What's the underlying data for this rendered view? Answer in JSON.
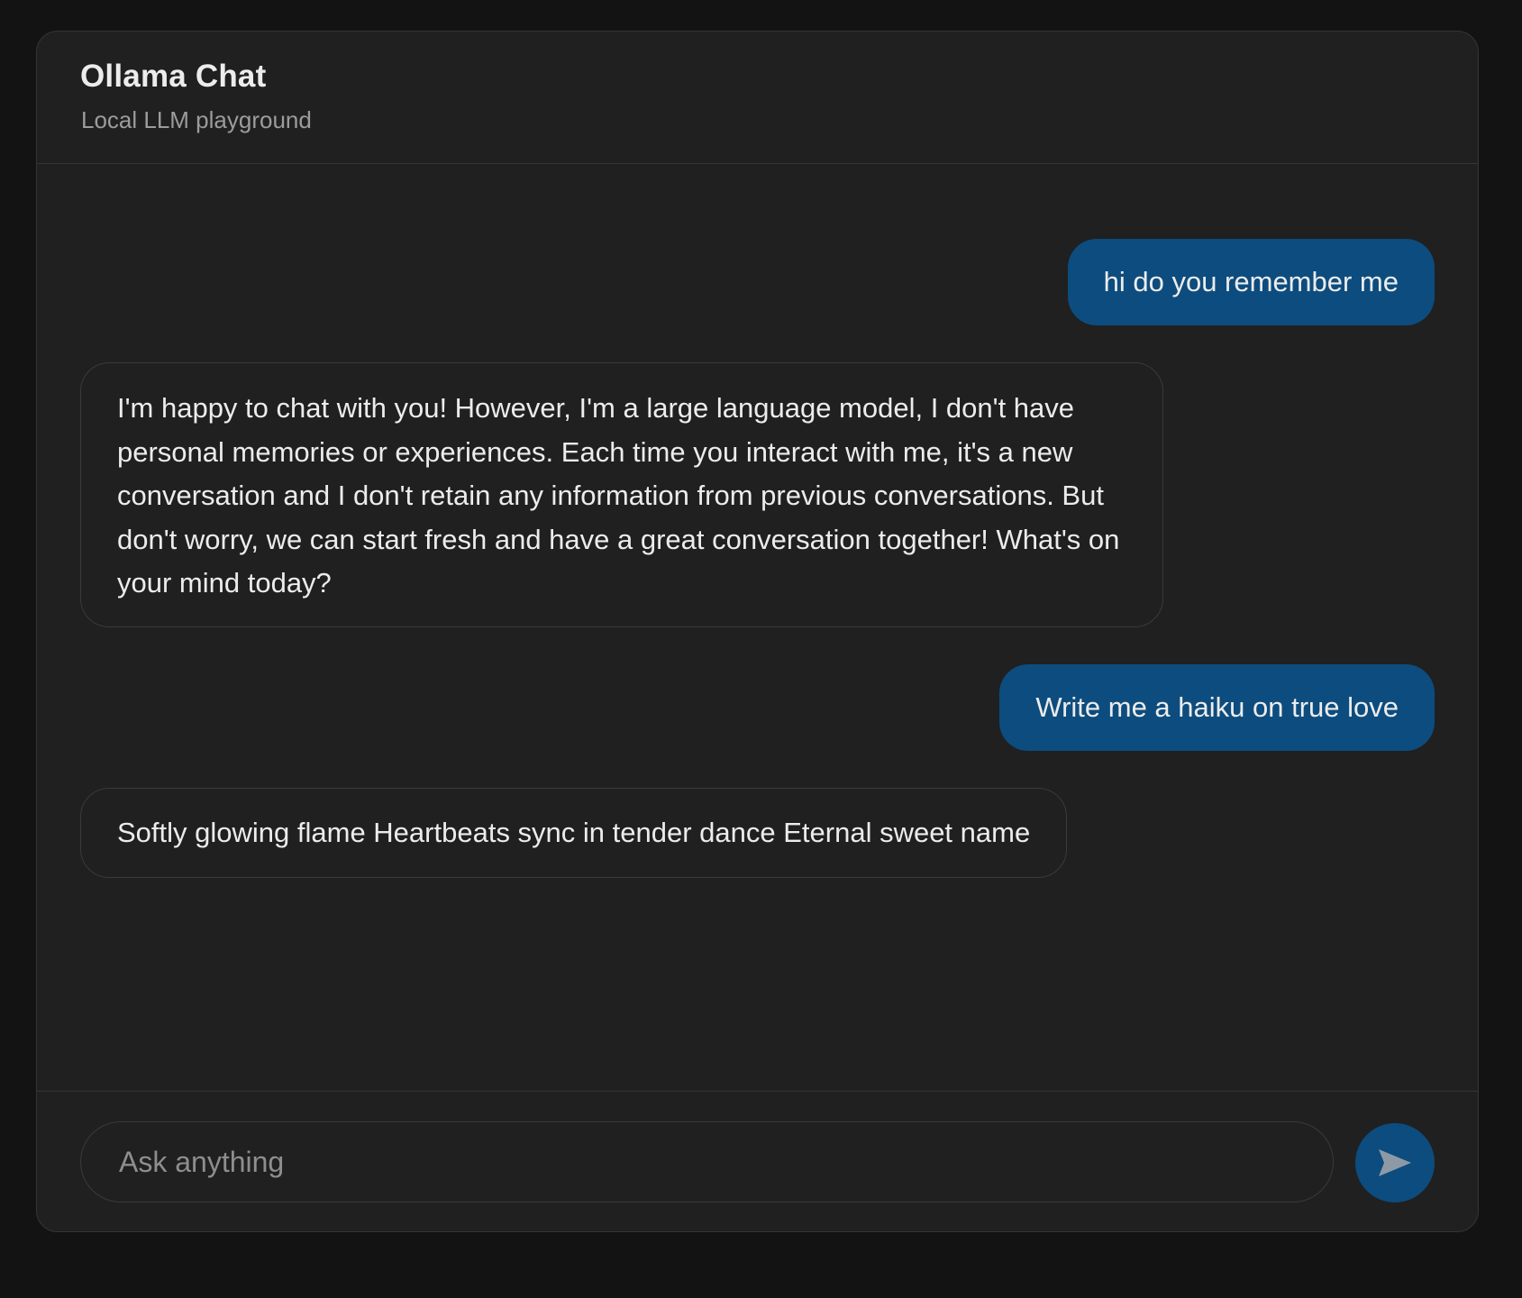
{
  "header": {
    "title": "Ollama Chat",
    "subtitle": "Local LLM playground"
  },
  "messages": [
    {
      "role": "user",
      "text": "hi do you remember me"
    },
    {
      "role": "assistant",
      "text": "I'm happy to chat with you! However, I'm a large language model, I don't have personal memories or experiences. Each time you interact with me, it's a new conversation and I don't retain any information from previous conversations. But don't worry, we can start fresh and have a great conversation together! What's on your mind today?"
    },
    {
      "role": "user",
      "text": "Write me a haiku on true love"
    },
    {
      "role": "assistant",
      "text": "Softly glowing flame Heartbeats sync in tender dance Eternal sweet name"
    }
  ],
  "composer": {
    "placeholder": "Ask anything",
    "value": "",
    "send_icon": "send-icon"
  },
  "colors": {
    "accent": "#0d4c7e",
    "panel": "#202020",
    "background": "#131313",
    "border": "#353535",
    "text": "#ececec",
    "muted_text": "#9c9c9c"
  }
}
